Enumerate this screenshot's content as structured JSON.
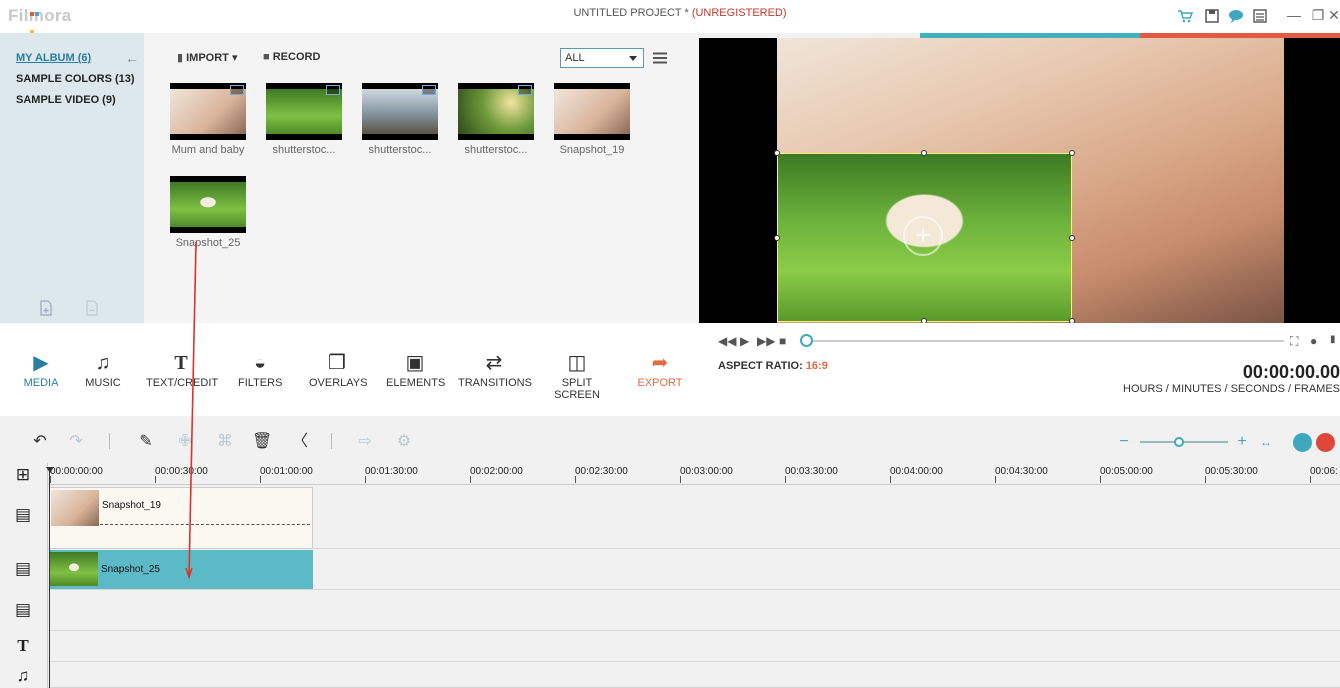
{
  "app": {
    "logo_text": "Filmora",
    "title": "UNTITLED PROJECT *",
    "registration": "(UNREGISTERED)"
  },
  "sidebar": {
    "items": [
      {
        "label": "MY ALBUM (6)"
      },
      {
        "label": "SAMPLE COLORS (13)"
      },
      {
        "label": "SAMPLE VIDEO (9)"
      }
    ]
  },
  "library": {
    "import_label": "IMPORT",
    "record_label": "RECORD",
    "filter_value": "ALL",
    "items": [
      {
        "label": "Mum and baby"
      },
      {
        "label": "shutterstoc..."
      },
      {
        "label": "shutterstoc..."
      },
      {
        "label": "shutterstoc..."
      },
      {
        "label": "Snapshot_19"
      },
      {
        "label": "Snapshot_25"
      }
    ]
  },
  "toolbar": {
    "tools": [
      {
        "label": "MEDIA"
      },
      {
        "label": "MUSIC"
      },
      {
        "label": "TEXT/CREDIT"
      },
      {
        "label": "FILTERS"
      },
      {
        "label": "OVERLAYS"
      },
      {
        "label": "ELEMENTS"
      },
      {
        "label": "TRANSITIONS"
      },
      {
        "label": "SPLIT SCREEN"
      },
      {
        "label": "EXPORT"
      }
    ]
  },
  "player": {
    "aspect_label": "ASPECT RATIO:",
    "aspect_value": "16:9",
    "timecode": "00:00:00.00",
    "timecode_units": "HOURS / MINUTES / SECONDS / FRAMES",
    "position": 0
  },
  "timeline": {
    "ruler": [
      "00:00:00:00",
      "00:00:30:00",
      "00:01:00:00",
      "00:01:30:00",
      "00:02:00:00",
      "00:02:30:00",
      "00:03:00:00",
      "00:03:30:00",
      "00:04:00:00",
      "00:04:30:00",
      "00:05:00:00",
      "00:05:30:00",
      "00:06:"
    ],
    "video_clip": "Snapshot_19",
    "pip_clip": "Snapshot_25"
  },
  "colors": {
    "accent": "#3fa7c0",
    "export": "#e06b45",
    "pip_track": "#5bbac6"
  }
}
